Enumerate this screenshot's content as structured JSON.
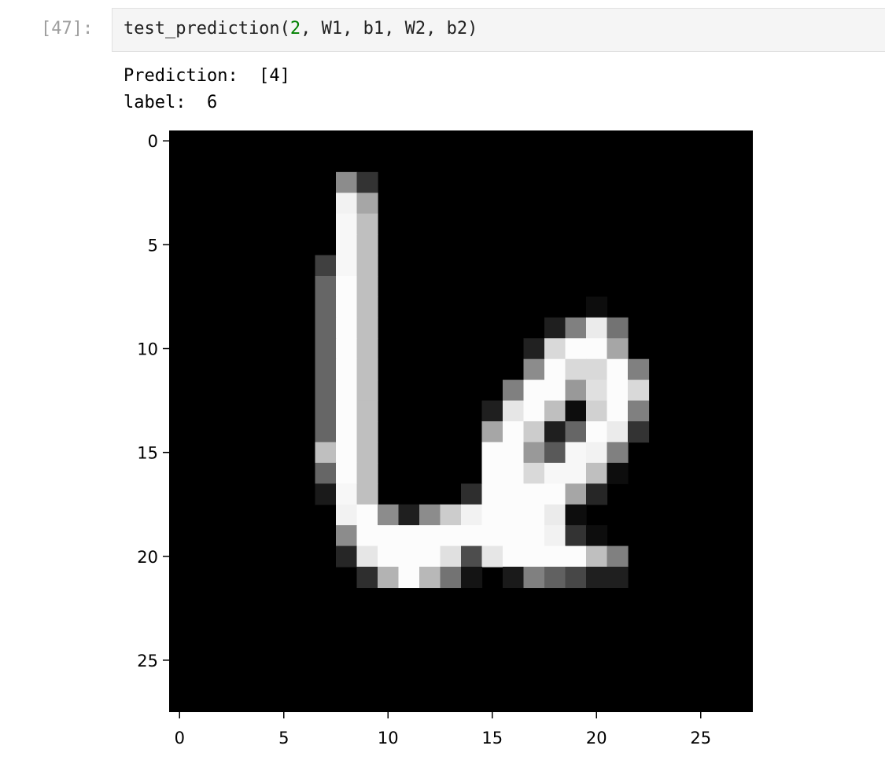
{
  "cell": {
    "prompt": "[47]:",
    "code": {
      "fn": "test_prediction(",
      "arg_num": "2",
      "rest": ", W1, b1, W2, b2)"
    }
  },
  "output": {
    "line1": "Prediction:  [4]",
    "line2": "label:  6"
  },
  "chart_data": {
    "type": "heatmap",
    "colormap": "gray",
    "xticks": [
      0,
      5,
      10,
      15,
      20,
      25
    ],
    "yticks": [
      0,
      5,
      10,
      15,
      20,
      25
    ],
    "xlim": [
      -0.5,
      27.5
    ],
    "ylim": [
      27.5,
      -0.5
    ],
    "grid": false,
    "image_size": [
      28,
      28
    ],
    "pixels": [
      [
        2,
        8,
        0.55
      ],
      [
        2,
        9,
        0.2
      ],
      [
        3,
        8,
        0.95
      ],
      [
        3,
        9,
        0.65
      ],
      [
        4,
        8,
        0.97
      ],
      [
        4,
        9,
        0.75
      ],
      [
        5,
        8,
        0.97
      ],
      [
        5,
        9,
        0.75
      ],
      [
        6,
        7,
        0.25
      ],
      [
        6,
        8,
        0.97
      ],
      [
        6,
        9,
        0.75
      ],
      [
        7,
        7,
        0.4
      ],
      [
        7,
        8,
        0.99
      ],
      [
        7,
        9,
        0.75
      ],
      [
        8,
        7,
        0.4
      ],
      [
        8,
        8,
        0.99
      ],
      [
        8,
        9,
        0.75
      ],
      [
        8,
        20,
        0.05
      ],
      [
        9,
        7,
        0.4
      ],
      [
        9,
        8,
        0.99
      ],
      [
        9,
        9,
        0.75
      ],
      [
        9,
        18,
        0.12
      ],
      [
        9,
        19,
        0.5
      ],
      [
        9,
        20,
        0.92
      ],
      [
        9,
        21,
        0.45
      ],
      [
        10,
        7,
        0.4
      ],
      [
        10,
        8,
        0.99
      ],
      [
        10,
        9,
        0.75
      ],
      [
        10,
        17,
        0.13
      ],
      [
        10,
        18,
        0.85
      ],
      [
        10,
        19,
        0.99
      ],
      [
        10,
        20,
        0.99
      ],
      [
        10,
        21,
        0.65
      ],
      [
        11,
        7,
        0.4
      ],
      [
        11,
        8,
        0.99
      ],
      [
        11,
        9,
        0.75
      ],
      [
        11,
        17,
        0.55
      ],
      [
        11,
        18,
        0.99
      ],
      [
        11,
        19,
        0.85
      ],
      [
        11,
        20,
        0.85
      ],
      [
        11,
        21,
        0.99
      ],
      [
        11,
        22,
        0.5
      ],
      [
        12,
        7,
        0.4
      ],
      [
        12,
        8,
        0.99
      ],
      [
        12,
        9,
        0.75
      ],
      [
        12,
        16,
        0.5
      ],
      [
        12,
        17,
        0.99
      ],
      [
        12,
        18,
        0.99
      ],
      [
        12,
        19,
        0.6
      ],
      [
        12,
        20,
        0.88
      ],
      [
        12,
        21,
        0.99
      ],
      [
        12,
        22,
        0.85
      ],
      [
        13,
        7,
        0.4
      ],
      [
        13,
        8,
        0.99
      ],
      [
        13,
        9,
        0.75
      ],
      [
        13,
        15,
        0.12
      ],
      [
        13,
        16,
        0.9
      ],
      [
        13,
        17,
        0.99
      ],
      [
        13,
        18,
        0.75
      ],
      [
        13,
        19,
        0.05
      ],
      [
        13,
        20,
        0.82
      ],
      [
        13,
        21,
        0.99
      ],
      [
        13,
        22,
        0.5
      ],
      [
        14,
        7,
        0.4
      ],
      [
        14,
        8,
        0.99
      ],
      [
        14,
        9,
        0.75
      ],
      [
        14,
        15,
        0.65
      ],
      [
        14,
        16,
        0.99
      ],
      [
        14,
        17,
        0.8
      ],
      [
        14,
        18,
        0.12
      ],
      [
        14,
        19,
        0.4
      ],
      [
        14,
        20,
        0.99
      ],
      [
        14,
        21,
        0.92
      ],
      [
        14,
        22,
        0.2
      ],
      [
        15,
        7,
        0.75
      ],
      [
        15,
        8,
        0.99
      ],
      [
        15,
        9,
        0.75
      ],
      [
        15,
        15,
        0.99
      ],
      [
        15,
        16,
        0.99
      ],
      [
        15,
        17,
        0.6
      ],
      [
        15,
        18,
        0.35
      ],
      [
        15,
        19,
        0.97
      ],
      [
        15,
        20,
        0.95
      ],
      [
        15,
        21,
        0.5
      ],
      [
        16,
        7,
        0.4
      ],
      [
        16,
        8,
        0.99
      ],
      [
        16,
        9,
        0.75
      ],
      [
        16,
        15,
        0.99
      ],
      [
        16,
        16,
        0.99
      ],
      [
        16,
        17,
        0.85
      ],
      [
        16,
        18,
        0.97
      ],
      [
        16,
        19,
        0.97
      ],
      [
        16,
        20,
        0.75
      ],
      [
        16,
        21,
        0.05
      ],
      [
        17,
        7,
        0.1
      ],
      [
        17,
        8,
        0.97
      ],
      [
        17,
        9,
        0.75
      ],
      [
        17,
        14,
        0.18
      ],
      [
        17,
        15,
        0.99
      ],
      [
        17,
        16,
        0.99
      ],
      [
        17,
        17,
        0.99
      ],
      [
        17,
        18,
        0.99
      ],
      [
        17,
        19,
        0.65
      ],
      [
        17,
        20,
        0.15
      ],
      [
        18,
        8,
        0.95
      ],
      [
        18,
        9,
        0.99
      ],
      [
        18,
        10,
        0.55
      ],
      [
        18,
        11,
        0.12
      ],
      [
        18,
        12,
        0.55
      ],
      [
        18,
        13,
        0.8
      ],
      [
        18,
        14,
        0.95
      ],
      [
        18,
        15,
        0.99
      ],
      [
        18,
        16,
        0.99
      ],
      [
        18,
        17,
        0.99
      ],
      [
        18,
        18,
        0.92
      ],
      [
        18,
        19,
        0.05
      ],
      [
        19,
        8,
        0.55
      ],
      [
        19,
        9,
        0.99
      ],
      [
        19,
        10,
        0.99
      ],
      [
        19,
        11,
        0.99
      ],
      [
        19,
        12,
        0.99
      ],
      [
        19,
        13,
        0.99
      ],
      [
        19,
        14,
        0.99
      ],
      [
        19,
        15,
        0.99
      ],
      [
        19,
        16,
        0.99
      ],
      [
        19,
        17,
        0.99
      ],
      [
        19,
        18,
        0.95
      ],
      [
        19,
        19,
        0.2
      ],
      [
        19,
        20,
        0.05
      ],
      [
        20,
        8,
        0.15
      ],
      [
        20,
        9,
        0.9
      ],
      [
        20,
        10,
        0.99
      ],
      [
        20,
        11,
        0.99
      ],
      [
        20,
        12,
        0.99
      ],
      [
        20,
        13,
        0.88
      ],
      [
        20,
        14,
        0.3
      ],
      [
        20,
        15,
        0.9
      ],
      [
        20,
        16,
        0.99
      ],
      [
        20,
        17,
        0.99
      ],
      [
        20,
        18,
        0.99
      ],
      [
        20,
        19,
        0.99
      ],
      [
        20,
        20,
        0.75
      ],
      [
        20,
        21,
        0.5
      ],
      [
        21,
        9,
        0.18
      ],
      [
        21,
        10,
        0.7
      ],
      [
        21,
        11,
        0.99
      ],
      [
        21,
        12,
        0.72
      ],
      [
        21,
        13,
        0.45
      ],
      [
        21,
        14,
        0.08
      ],
      [
        21,
        16,
        0.1
      ],
      [
        21,
        17,
        0.5
      ],
      [
        21,
        18,
        0.38
      ],
      [
        21,
        19,
        0.28
      ],
      [
        21,
        20,
        0.12
      ],
      [
        21,
        21,
        0.12
      ]
    ]
  }
}
